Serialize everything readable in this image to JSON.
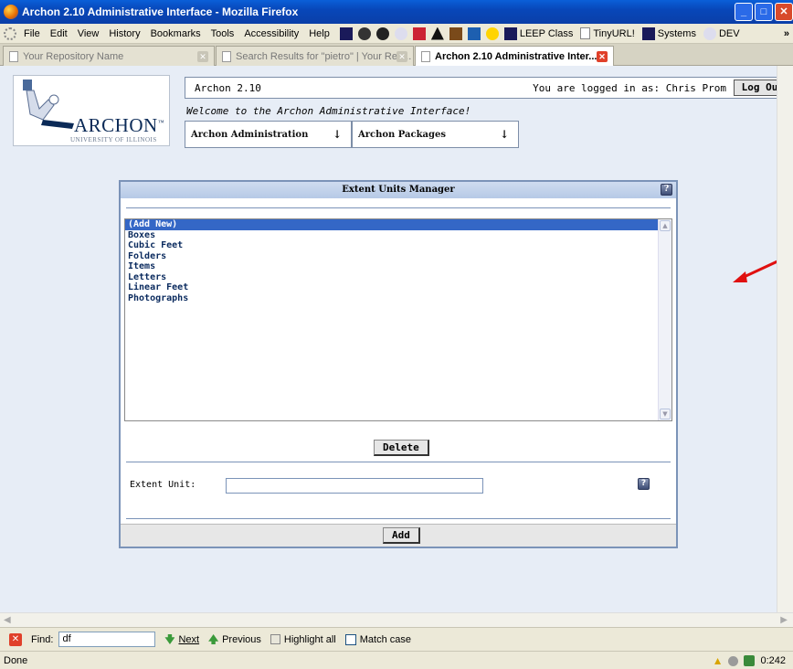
{
  "window": {
    "title": "Archon 2.10 Administrative Interface - Mozilla Firefox"
  },
  "menu": [
    "File",
    "Edit",
    "View",
    "History",
    "Bookmarks",
    "Tools",
    "Accessibility",
    "Help"
  ],
  "bookmarks": [
    "LEEP Class",
    "TinyURL!",
    "Systems",
    "DEV"
  ],
  "tabs": [
    {
      "label": "Your Repository Name"
    },
    {
      "label": "Search Results for \"pietro\" | Your Rep..."
    },
    {
      "label": "Archon 2.10 Administrative Inter..."
    }
  ],
  "logo": {
    "name": "ARCHON",
    "tm": "™",
    "subtitle": "UNIVERSITY OF ILLINOIS"
  },
  "header": {
    "version": "Archon 2.10",
    "login_text": "You are logged in as: Chris Prom",
    "logout_label": "Log Out",
    "welcome": "Welcome to the Archon Administrative Interface!"
  },
  "nav": {
    "admin": {
      "label": "Archon Administration",
      "arrow": "↓"
    },
    "packages": {
      "label": "Archon Packages",
      "arrow": "↓"
    }
  },
  "panel": {
    "title": "Extent Units Manager",
    "items": [
      "(Add New)",
      "Boxes",
      "Cubic Feet",
      "Folders",
      "Items",
      "Letters",
      "Linear Feet",
      "Photographs"
    ],
    "selected_index": 0,
    "delete_label": "Delete",
    "field_label": "Extent Unit:",
    "field_value": "",
    "add_label": "Add"
  },
  "findbar": {
    "label": "Find:",
    "value": "df",
    "next": "Next",
    "previous": "Previous",
    "highlight_all": "Highlight all",
    "match_case": "Match case"
  },
  "status": {
    "text": "Done",
    "time": "0:242"
  },
  "colors": {
    "annotation_arrow": "#e01010"
  }
}
